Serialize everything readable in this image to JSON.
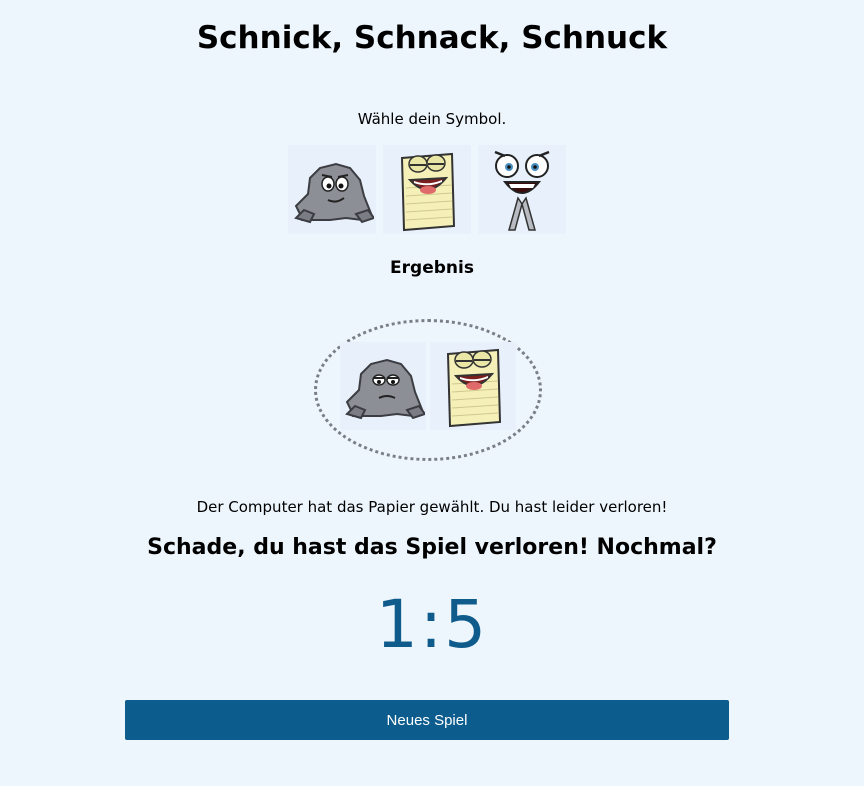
{
  "game": {
    "title": "Schnick, Schnack, Schnuck",
    "prompt": "Wähle dein Symbol.",
    "choices": [
      {
        "icon": "rock-icon"
      },
      {
        "icon": "paper-icon"
      },
      {
        "icon": "scissors-icon"
      }
    ],
    "result_heading": "Ergebnis",
    "result": {
      "player": "rock-icon",
      "computer": "paper-icon"
    },
    "message": "Der Computer hat das Papier gewählt. Du hast leider verloren!",
    "final_message": "Schade, du hast das Spiel verloren! Nochmal?",
    "score": "1:5",
    "new_game_label": "Neues Spiel"
  },
  "colors": {
    "background": "#eef6fd",
    "accent": "#0c5c8e",
    "score": "#0f5b8c"
  }
}
